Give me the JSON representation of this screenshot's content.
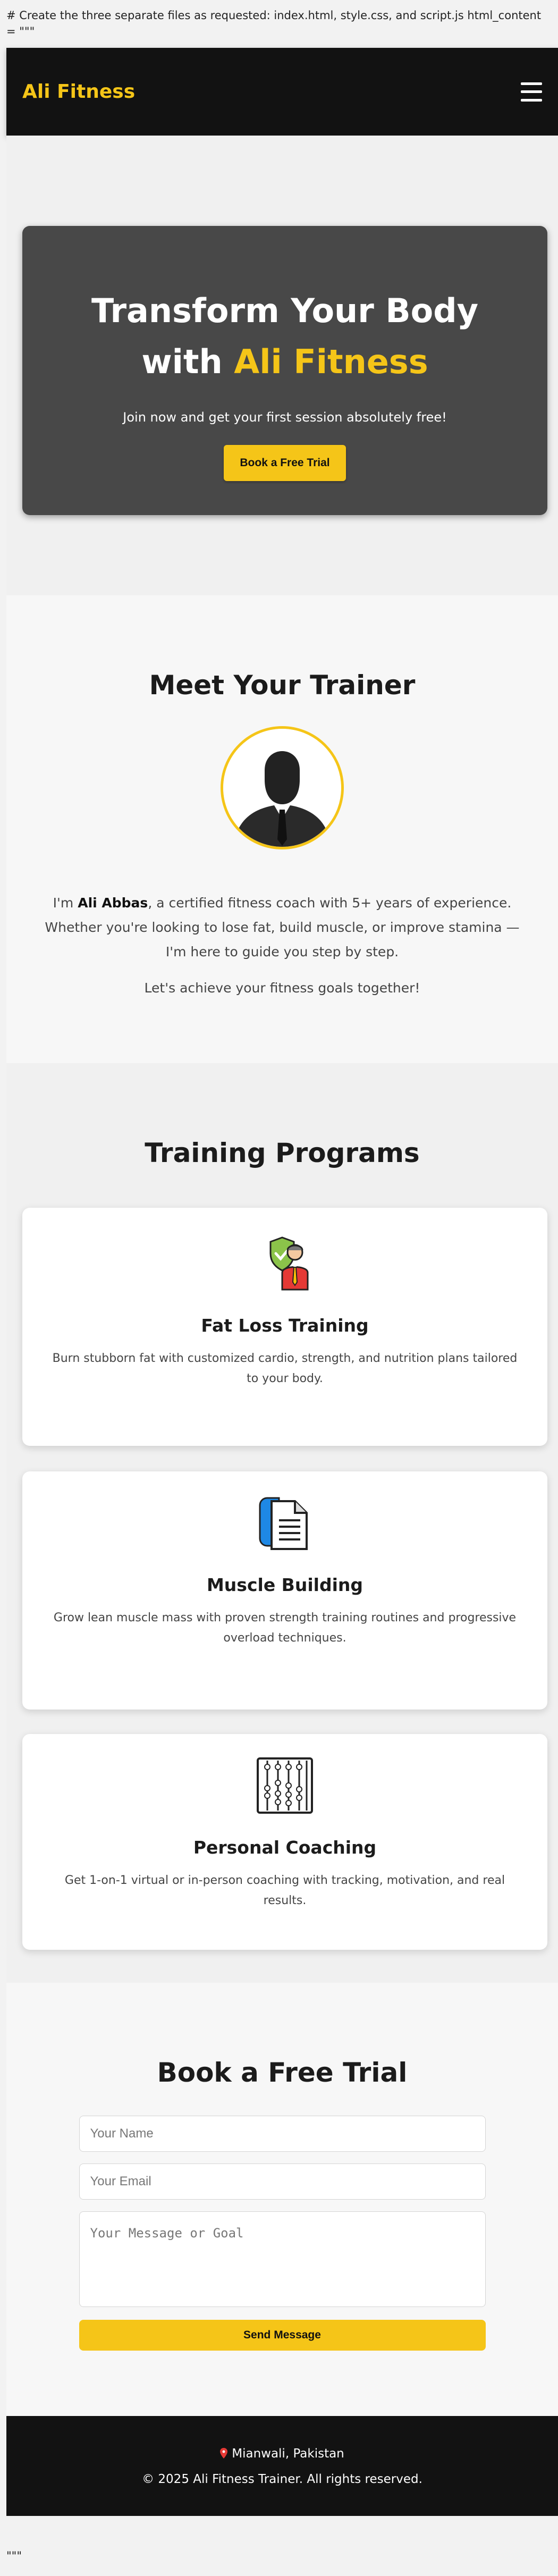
{
  "document": {
    "top_text": "# Create the three separate files as requested: index.html, style.css, and script.js html_content = \"\"\"",
    "bottom_text": "\"\"\""
  },
  "header": {
    "logo": "Ali Fitness",
    "menu_icon": "hamburger-menu-icon"
  },
  "hero": {
    "title_part1": "Transform Your Body with",
    "title_accent": "Ali Fitness",
    "subtitle": "Join now and get your first session absolutely free!",
    "cta_label": "Book a Free Trial",
    "accent_color": "#f5c518",
    "background_color": "#484848"
  },
  "trainer": {
    "heading": "Meet Your Trainer",
    "avatar_icon": "businessman-silhouette-icon",
    "bio_prefix": "I'm",
    "bio_name": "Ali Abbas",
    "bio_rest": ", a certified fitness coach with 5+ years of experience. Whether you're looking to lose fat, build muscle, or improve stamina — I'm here to guide you step by step.",
    "bio2": "Let's achieve your fitness goals together!"
  },
  "programs": {
    "heading": "Training Programs",
    "items": [
      {
        "title": "Fat Loss Training",
        "description": "Burn stubborn fat with customized cardio, strength, and nutrition plans tailored to your body.",
        "icon": "shield-person-icon"
      },
      {
        "title": "Muscle Building",
        "description": "Grow lean muscle mass with proven strength training routines and progressive overload techniques.",
        "icon": "document-folder-icon"
      },
      {
        "title": "Personal Coaching",
        "description": "Get 1-on-1 virtual or in-person coaching with tracking, motivation, and real results.",
        "icon": "abacus-icon"
      }
    ]
  },
  "contact": {
    "heading": "Book a Free Trial",
    "name_placeholder": "Your Name",
    "email_placeholder": "Your Email",
    "message_placeholder": "Your Message or Goal",
    "submit_label": "Send Message"
  },
  "footer": {
    "location": "Mianwali, Pakistan",
    "location_icon": "map-pin-icon",
    "copyright": "© 2025 Ali Fitness Trainer. All rights reserved."
  }
}
